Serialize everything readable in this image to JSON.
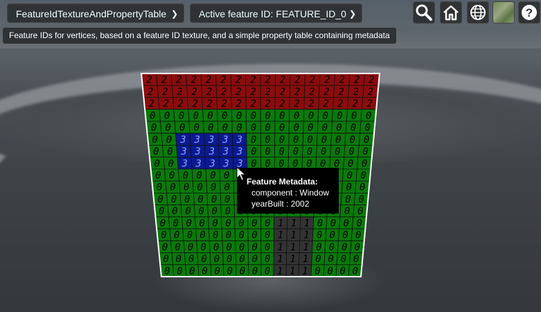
{
  "toolbar": {
    "sandcastle_select": "FeatureIdTextureAndPropertyTable",
    "feature_id_select": "Active feature ID: FEATURE_ID_0"
  },
  "info_text": "Feature IDs for vertices, based on a feature ID texture, and a simple property table containing metadata",
  "icons": {
    "search": "search-icon",
    "home": "home-icon",
    "scene_mode": "globe-icon",
    "imagery": "imagery-thumbnail-icon",
    "help": "help-icon"
  },
  "tooltip": {
    "title": "Feature Metadata:",
    "component_label": "component : Window",
    "year_label": "yearBuilt : 2002"
  },
  "texture": {
    "rows": [
      "2222222222222222",
      "2222222222222222",
      "2222222222222222",
      "0000000000000000",
      "0000000000000000",
      "0033333000000000",
      "0033333000000000",
      "0033333000000000",
      "0000000000000000",
      "0000000000000000",
      "0000000000000000",
      "0000000000000000",
      "0000000001110000",
      "0000000001110000",
      "0000000001110000",
      "0000000001110000",
      "0000000001110000"
    ],
    "colors": {
      "0": "#0a7a0a",
      "1": "#333333",
      "2": "#8b0d0d",
      "3": "#0b1a8f"
    }
  }
}
